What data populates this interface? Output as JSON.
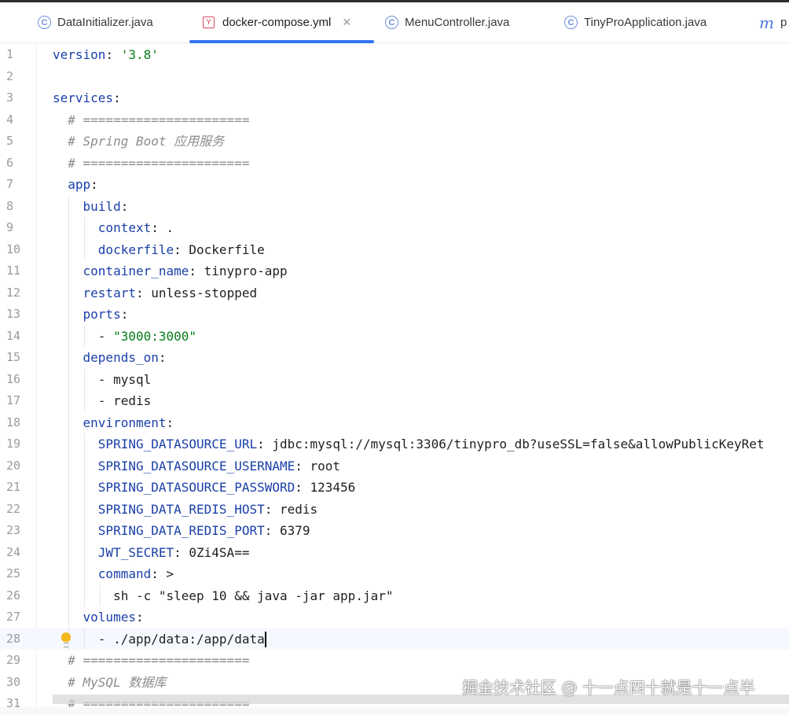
{
  "tabs": [
    {
      "label": "DataInitializer.java",
      "icon": "class-icon"
    },
    {
      "label": "docker-compose.yml",
      "icon": "yaml-icon",
      "active": true
    },
    {
      "label": "MenuController.java",
      "icon": "class-icon"
    },
    {
      "label": "TinyProApplication.java",
      "icon": "run-class-icon"
    },
    {
      "label": "p",
      "icon": "maven-icon"
    }
  ],
  "editor": {
    "current_line": 28,
    "lines": [
      {
        "n": "1",
        "seg": [
          [
            "version",
            "k"
          ],
          [
            ": ",
            "v"
          ],
          [
            "'3.8'",
            "s"
          ]
        ]
      },
      {
        "n": "2",
        "seg": []
      },
      {
        "n": "3",
        "seg": [
          [
            "services",
            "k"
          ],
          [
            ":",
            "v"
          ]
        ]
      },
      {
        "n": "4",
        "seg": [
          [
            "  # ======================",
            "c"
          ]
        ]
      },
      {
        "n": "5",
        "seg": [
          [
            "  # Spring Boot 应用服务",
            "c"
          ]
        ]
      },
      {
        "n": "6",
        "seg": [
          [
            "  # ======================",
            "c"
          ]
        ]
      },
      {
        "n": "7",
        "seg": [
          [
            "  app",
            "k"
          ],
          [
            ":",
            "v"
          ]
        ]
      },
      {
        "n": "8",
        "seg": [
          [
            "    build",
            "k"
          ],
          [
            ":",
            "v"
          ]
        ]
      },
      {
        "n": "9",
        "seg": [
          [
            "      context",
            "k"
          ],
          [
            ": .",
            "v"
          ]
        ]
      },
      {
        "n": "10",
        "seg": [
          [
            "      dockerfile",
            "k"
          ],
          [
            ": Dockerfile",
            "v"
          ]
        ]
      },
      {
        "n": "11",
        "seg": [
          [
            "    container_name",
            "k"
          ],
          [
            ": tinypro-app",
            "v"
          ]
        ]
      },
      {
        "n": "12",
        "seg": [
          [
            "    restart",
            "k"
          ],
          [
            ": unless-stopped",
            "v"
          ]
        ]
      },
      {
        "n": "13",
        "seg": [
          [
            "    ports",
            "k"
          ],
          [
            ":",
            "v"
          ]
        ]
      },
      {
        "n": "14",
        "seg": [
          [
            "      - ",
            "v"
          ],
          [
            "\"3000:3000\"",
            "s"
          ]
        ]
      },
      {
        "n": "15",
        "seg": [
          [
            "    depends_on",
            "k"
          ],
          [
            ":",
            "v"
          ]
        ]
      },
      {
        "n": "16",
        "seg": [
          [
            "      - mysql",
            "v"
          ]
        ]
      },
      {
        "n": "17",
        "seg": [
          [
            "      - redis",
            "v"
          ]
        ]
      },
      {
        "n": "18",
        "seg": [
          [
            "    environment",
            "k"
          ],
          [
            ":",
            "v"
          ]
        ]
      },
      {
        "n": "19",
        "seg": [
          [
            "      SPRING_DATASOURCE_URL",
            "k"
          ],
          [
            ": jdbc:mysql://mysql:3306/tinypro_db?useSSL=false&allowPublicKeyRet",
            "v"
          ]
        ]
      },
      {
        "n": "20",
        "seg": [
          [
            "      SPRING_DATASOURCE_USERNAME",
            "k"
          ],
          [
            ": root",
            "v"
          ]
        ]
      },
      {
        "n": "21",
        "seg": [
          [
            "      SPRING_DATASOURCE_PASSWORD",
            "k"
          ],
          [
            ": 123456",
            "v"
          ]
        ]
      },
      {
        "n": "22",
        "seg": [
          [
            "      SPRING_DATA_REDIS_HOST",
            "k"
          ],
          [
            ": redis",
            "v"
          ]
        ]
      },
      {
        "n": "23",
        "seg": [
          [
            "      SPRING_DATA_REDIS_PORT",
            "k"
          ],
          [
            ": 6379",
            "v"
          ]
        ]
      },
      {
        "n": "24",
        "seg": [
          [
            "      JWT_SECRET",
            "k"
          ],
          [
            ": 0Zi4SA==",
            "v"
          ]
        ]
      },
      {
        "n": "25",
        "seg": [
          [
            "      command",
            "k"
          ],
          [
            ": >",
            "v"
          ]
        ]
      },
      {
        "n": "26",
        "seg": [
          [
            "        sh -c \"sleep 10 && java -jar app.jar\"",
            "v"
          ]
        ]
      },
      {
        "n": "27",
        "seg": [
          [
            "    volumes",
            "k"
          ],
          [
            ":",
            "v"
          ]
        ]
      },
      {
        "n": "28",
        "seg": [
          [
            "      - ./app/data:/app/data",
            "v"
          ]
        ]
      },
      {
        "n": "29",
        "seg": [
          [
            "  # ======================",
            "c"
          ]
        ]
      },
      {
        "n": "30",
        "seg": [
          [
            "  # MySQL 数据库",
            "c"
          ]
        ]
      },
      {
        "n": "31",
        "seg": [
          [
            "  # ======================",
            "c"
          ]
        ]
      }
    ]
  },
  "watermark": "掘金技术社区 @ 十一点四十就是十一点半"
}
